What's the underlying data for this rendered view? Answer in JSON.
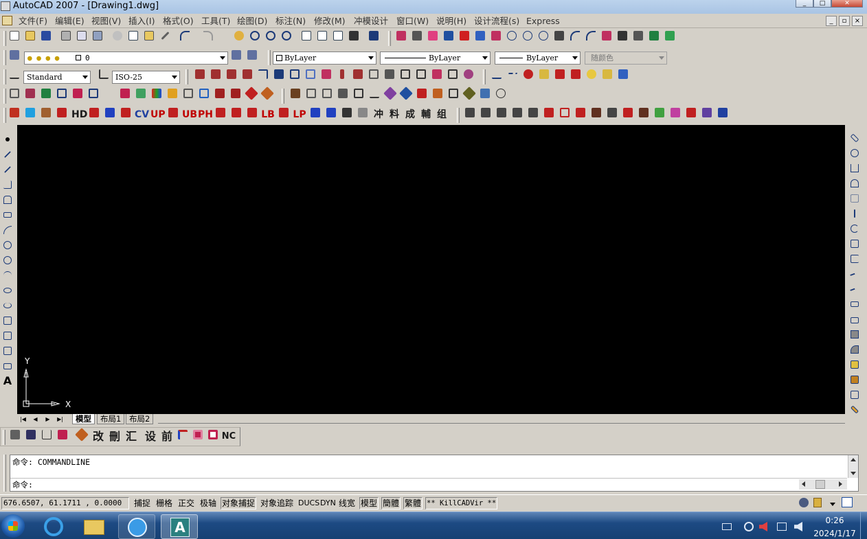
{
  "window": {
    "title": "AutoCAD 2007 - [Drawing1.dwg]",
    "minimize_glyph": "_",
    "restore_glyph": "□",
    "close_glyph": "✕"
  },
  "menu": {
    "items": [
      "文件(F)",
      "编辑(E)",
      "视图(V)",
      "插入(I)",
      "格式(O)",
      "工具(T)",
      "绘图(D)",
      "标注(N)",
      "修改(M)",
      "冲模设计",
      "窗口(W)",
      "说明(H)",
      "设计流程(s)",
      "Express"
    ]
  },
  "mdi": {
    "minimize": "_",
    "restore": "▫",
    "close": "×"
  },
  "layers": {
    "current_layer": "0"
  },
  "properties": {
    "color": "ByLayer",
    "linetype": "ByLayer",
    "lineweight": "ByLayer",
    "plotstyle": "随颜色"
  },
  "styles": {
    "text_style": "Standard",
    "dim_style": "ISO-25"
  },
  "custom_toolbar": {
    "labels": [
      "HD",
      "CV",
      "UP",
      "UB",
      "PH",
      "LB",
      "LP",
      "冲",
      "料",
      "成",
      "輔",
      "组"
    ]
  },
  "drawing_toolbar": {
    "labels": [
      "改",
      "刪",
      "汇",
      "设",
      "前",
      "NC"
    ]
  },
  "ucs": {
    "x_label": "X",
    "y_label": "Y"
  },
  "layout_tabs": {
    "tabs": [
      "模型",
      "布局1",
      "布局2"
    ],
    "nav": [
      "|◀",
      "◀",
      "▶",
      "▶|"
    ]
  },
  "command": {
    "history": "命令: COMMANDLINE",
    "prompt": "命令:"
  },
  "status": {
    "coordinates": "676.6507,  61.1711 , 0.0000",
    "toggles": [
      {
        "label": "捕捉",
        "on": false
      },
      {
        "label": "栅格",
        "on": false
      },
      {
        "label": "正交",
        "on": false
      },
      {
        "label": "极轴",
        "on": false
      },
      {
        "label": "对象捕捉",
        "on": true
      },
      {
        "label": "对象追踪",
        "on": false
      },
      {
        "label": "DUCS",
        "on": false
      },
      {
        "label": "DYN",
        "on": false
      },
      {
        "label": "线宽",
        "on": false
      },
      {
        "label": "模型",
        "on": true
      },
      {
        "label": "簡體",
        "on": true
      },
      {
        "label": "繁體",
        "on": true
      },
      {
        "label": "** KillCADVir **",
        "on": true
      }
    ]
  },
  "taskbar": {
    "time": "0:26",
    "date": "2024/1/17",
    "app_label": "A"
  },
  "colors": {
    "canvas": "#000000",
    "chrome": "#d4d0c8",
    "titlebar": "#b8cfea",
    "taskbar": "#1d4a83",
    "red_icon": "#c00000"
  }
}
